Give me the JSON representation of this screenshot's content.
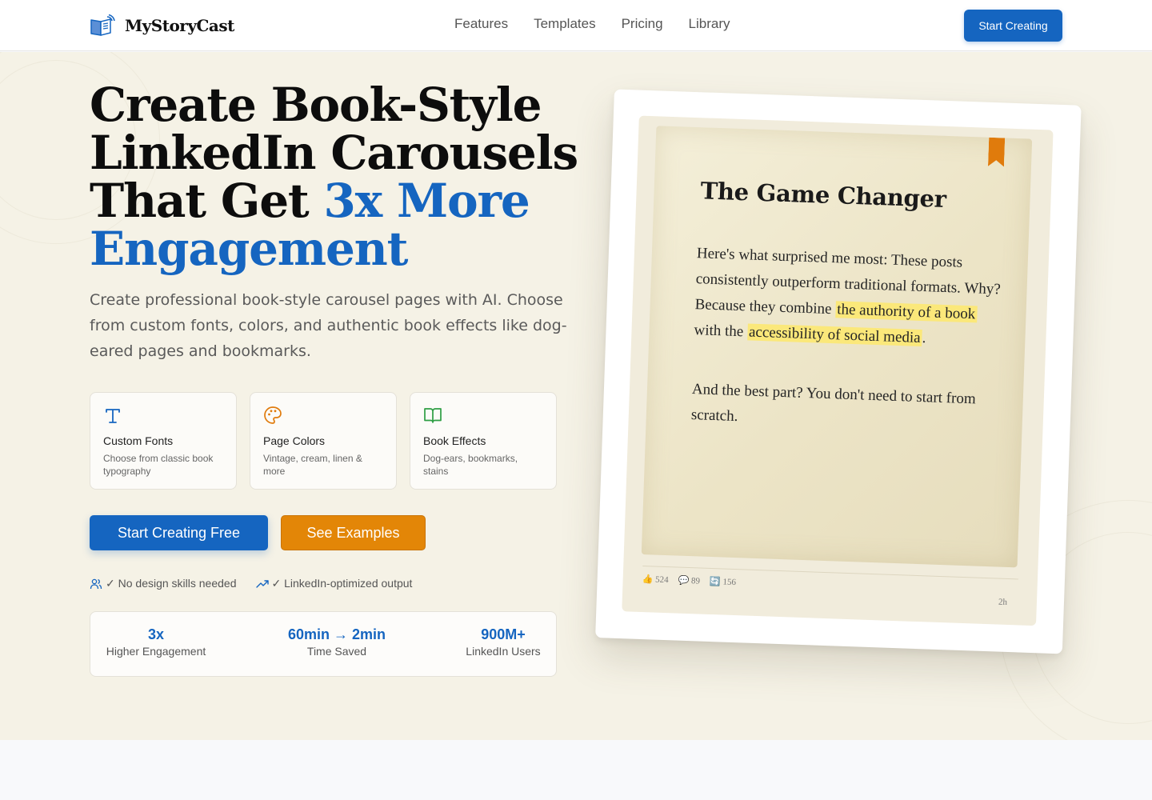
{
  "brand": {
    "name": "MyStoryCast",
    "icon": "open-book-broadcast-icon"
  },
  "nav": {
    "links": [
      "Features",
      "Templates",
      "Pricing",
      "Library"
    ],
    "cta": "Start Creating"
  },
  "hero": {
    "headline_line1": "Create Book-Style",
    "headline_line2": "LinkedIn Carousels",
    "headline_line3a": "That Get ",
    "headline_line3b": "3x More",
    "headline_line4": "Engagement",
    "subtitle": "Create professional book-style carousel pages with AI. Choose from custom fonts, colors, and authentic book effects like dog-eared pages and bookmarks.",
    "features": [
      {
        "icon": "type-icon",
        "title": "Custom Fonts",
        "desc": "Choose from classic book typography"
      },
      {
        "icon": "palette-icon",
        "title": "Page Colors",
        "desc": "Vintage, cream, linen & more"
      },
      {
        "icon": "book-open-icon",
        "title": "Book Effects",
        "desc": "Dog-ears, bookmarks, stains"
      }
    ],
    "primary_button": "Start Creating Free",
    "secondary_button": "See Examples",
    "perks": [
      "✓ No design skills needed",
      "✓ LinkedIn-optimized output"
    ],
    "stats": [
      {
        "value": "3x",
        "label": "Higher Engagement"
      },
      {
        "value": "60min → 2min",
        "label": "Time Saved"
      },
      {
        "value": "900M+",
        "label": "LinkedIn Users"
      }
    ]
  },
  "preview": {
    "title": "The Game Changer",
    "body_pre": "Here's what surprised me most: These posts consistently outperform traditional formats. Why? Because they combine ",
    "highlight1": "the authority of a book",
    "body_mid": " with the ",
    "highlight2": "accessibility of social media",
    "body_end": ".",
    "body2": "And the best part? You don't need to start from scratch.",
    "reactions": "👍 524",
    "comments": "💬 89",
    "reposts": "🔄 156",
    "time": "2h"
  },
  "colors": {
    "primary": "#1565c0",
    "secondary": "#e38607",
    "hero_bg": "#f5f2e6",
    "highlight": "#fbe87a"
  }
}
